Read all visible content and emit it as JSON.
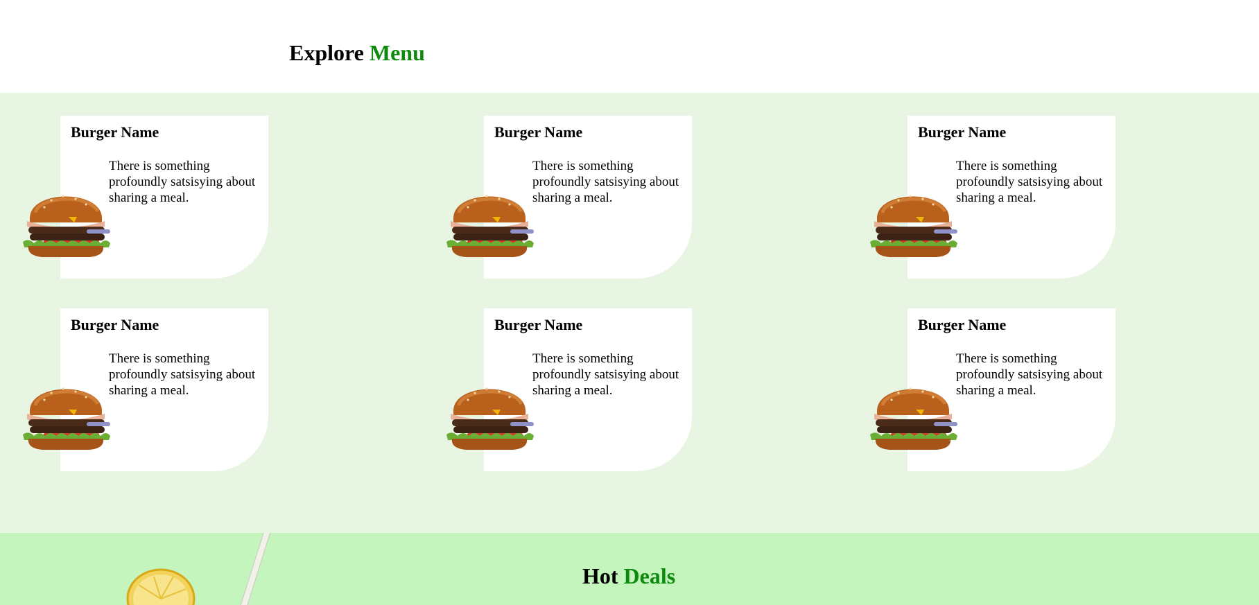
{
  "header": {
    "title_prefix": "Explore",
    "title_accent": "Menu"
  },
  "menu": {
    "items": [
      {
        "name": "Burger Name",
        "description": "There is something profoundly satsisying about sharing a meal.",
        "icon": "burger-icon"
      },
      {
        "name": "Burger Name",
        "description": "There is something profoundly satsisying about sharing a meal.",
        "icon": "burger-icon"
      },
      {
        "name": "Burger Name",
        "description": "There is something profoundly satsisying about sharing a meal.",
        "icon": "burger-icon"
      },
      {
        "name": "Burger Name",
        "description": "There is something profoundly satsisying about sharing a meal.",
        "icon": "burger-icon"
      },
      {
        "name": "Burger Name",
        "description": "There is something profoundly satsisying about sharing a meal.",
        "icon": "burger-icon"
      },
      {
        "name": "Burger Name",
        "description": "There is something profoundly satsisying about sharing a meal.",
        "icon": "burger-icon"
      }
    ]
  },
  "deals": {
    "title_prefix": "Hot",
    "title_accent": "Deals",
    "icon": "lemonade-icon"
  },
  "colors": {
    "accent": "#0d8a0d",
    "menu_background": "#e8f5e3",
    "deals_background": "#c3f5bc",
    "card_background": "#ffffff"
  }
}
